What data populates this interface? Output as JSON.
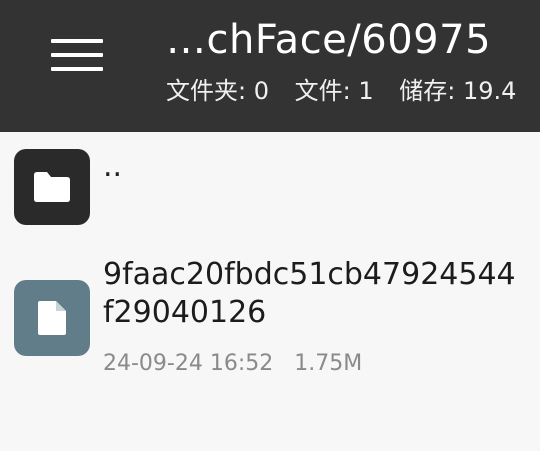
{
  "header": {
    "title": "…chFace/60975",
    "stats": {
      "folders": "文件夹: 0",
      "files": "文件: 1",
      "storage": "储存: 19.4"
    }
  },
  "list": {
    "up_item": {
      "label": ".."
    },
    "files": [
      {
        "name": "9faac20fbdc51cb47924544f29040126",
        "date": "24-09-24 16:52",
        "size": "1.75M"
      }
    ]
  },
  "colors": {
    "appbar": "#333333",
    "background": "#f7f7f7",
    "folder_icon_bg": "#2a2a2a",
    "file_icon_bg": "#627d8a"
  }
}
